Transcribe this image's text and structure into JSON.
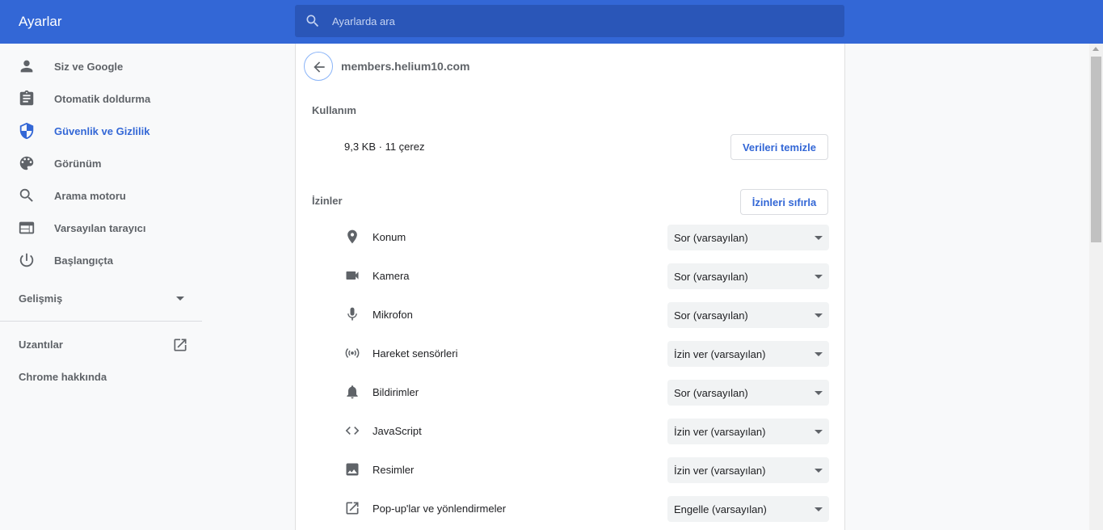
{
  "header": {
    "title": "Ayarlar",
    "search_placeholder": "Ayarlarda ara"
  },
  "sidebar": {
    "items": [
      {
        "label": "Siz ve Google",
        "icon": "person-icon"
      },
      {
        "label": "Otomatik doldurma",
        "icon": "clipboard-icon"
      },
      {
        "label": "Güvenlik ve Gizlilik",
        "icon": "shield-icon",
        "active": true
      },
      {
        "label": "Görünüm",
        "icon": "palette-icon"
      },
      {
        "label": "Arama motoru",
        "icon": "search-icon"
      },
      {
        "label": "Varsayılan tarayıcı",
        "icon": "browser-icon"
      },
      {
        "label": "Başlangıçta",
        "icon": "power-icon"
      }
    ],
    "advanced_label": "Gelişmiş",
    "extensions_label": "Uzantılar",
    "about_label": "Chrome hakkında"
  },
  "site": {
    "name": "members.helium10.com",
    "usage_heading": "Kullanım",
    "usage_text": "9,3 KB · 11 çerez",
    "clear_button": "Verileri temizle",
    "permissions_heading": "İzinler",
    "reset_button": "İzinleri sıfırla"
  },
  "permissions": [
    {
      "label": "Konum",
      "value": "Sor (varsayılan)",
      "icon": "location-pin-icon"
    },
    {
      "label": "Kamera",
      "value": "Sor (varsayılan)",
      "icon": "camera-icon"
    },
    {
      "label": "Mikrofon",
      "value": "Sor (varsayılan)",
      "icon": "microphone-icon"
    },
    {
      "label": "Hareket sensörleri",
      "value": "İzin ver (varsayılan)",
      "icon": "sensors-icon"
    },
    {
      "label": "Bildirimler",
      "value": "Sor (varsayılan)",
      "icon": "bell-icon"
    },
    {
      "label": "JavaScript",
      "value": "İzin ver (varsayılan)",
      "icon": "code-icon"
    },
    {
      "label": "Resimler",
      "value": "İzin ver (varsayılan)",
      "icon": "image-icon"
    },
    {
      "label": "Pop-up'lar ve yönlendirmeler",
      "value": "Engelle (varsayılan)",
      "icon": "open-in-new-icon"
    }
  ],
  "colors": {
    "accent": "#3367d6",
    "header_bg": "#3367d6",
    "text_secondary": "#5f6368"
  }
}
